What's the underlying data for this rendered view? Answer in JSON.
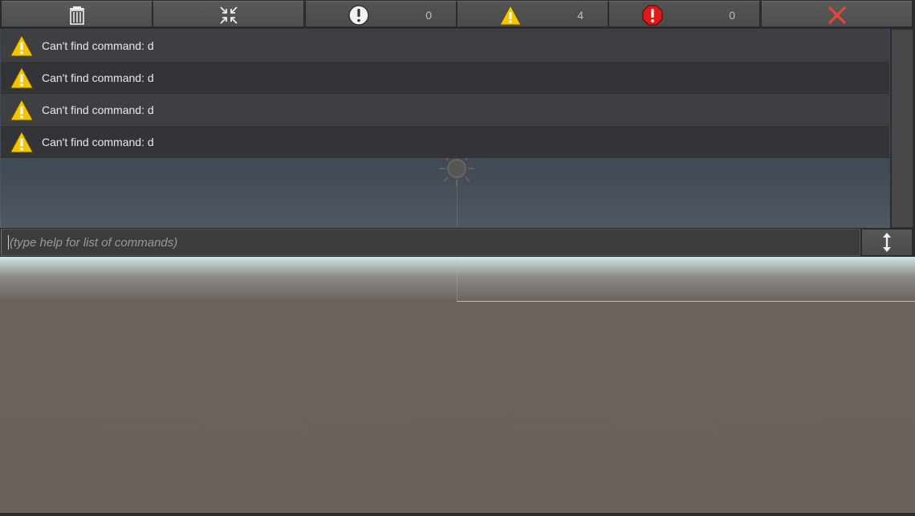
{
  "toolbar": {
    "buttons": [
      {
        "name": "clear",
        "icon": "trash-icon"
      },
      {
        "name": "collapse",
        "icon": "collapse-arrows-icon"
      },
      {
        "name": "info-filter",
        "icon": "info-icon",
        "count": "0"
      },
      {
        "name": "warning-filter",
        "icon": "warning-icon",
        "count": "4"
      },
      {
        "name": "error-filter",
        "icon": "error-icon",
        "count": "0"
      },
      {
        "name": "close",
        "icon": "close-icon"
      }
    ]
  },
  "log": {
    "entries": [
      {
        "type": "warning",
        "text": "Can't find command: d"
      },
      {
        "type": "warning",
        "text": "Can't find command: d"
      },
      {
        "type": "warning",
        "text": "Can't find command: d"
      },
      {
        "type": "warning",
        "text": "Can't find command: d"
      }
    ]
  },
  "input": {
    "value": "",
    "placeholder": "(type help for list of commands)"
  },
  "colors": {
    "warning": "#f5c400",
    "error": "#e01919",
    "close": "#e8443a",
    "toolbar_bg": "#4e4e4e",
    "row_text": "#e9e9e9"
  }
}
